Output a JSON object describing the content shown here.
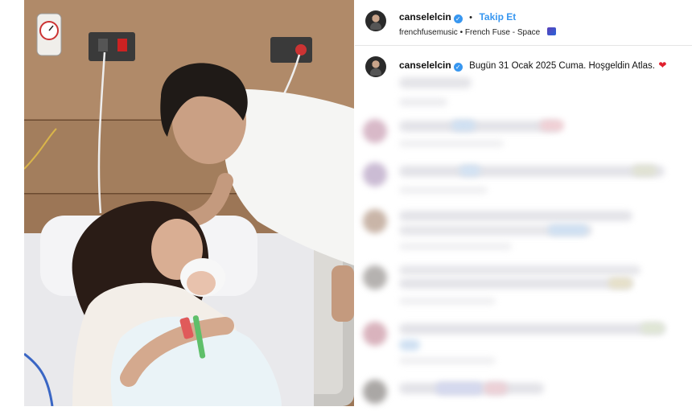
{
  "post": {
    "username": "canselelcin",
    "follow_label": "Takip Et",
    "separator": "•",
    "audio_line": "frenchfusemusic • French Fuse - Space",
    "music_icon": "music-emoji-icon",
    "caption_text": "Bugün 31 Ocak 2025 Cuma. Hoşgeldin Atlas.",
    "caption_emoji": "❤"
  },
  "colors": {
    "accent": "#3897f0",
    "heart": "#e0202e"
  }
}
